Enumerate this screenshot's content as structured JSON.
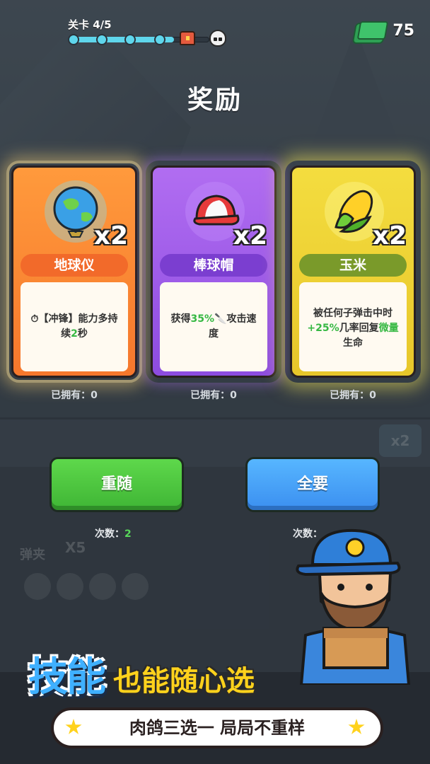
{
  "hud": {
    "level_label": "关卡 4/5",
    "progress": 0.75,
    "cash": "75"
  },
  "title": "奖励",
  "cards": [
    {
      "name": "地球仪",
      "count": "x2",
      "desc_prefix": "⏱【冲锋】能力多持续",
      "desc_highlight": "2",
      "desc_suffix": "秒",
      "owned": "已拥有：0",
      "icon": "globe-icon",
      "color": "#f6772c"
    },
    {
      "name": "棒球帽",
      "count": "x2",
      "desc_prefix": "获得",
      "desc_highlight": "35%",
      "desc_suffix": "🔪攻击速度",
      "owned": "已拥有：0",
      "icon": "baseball-cap-icon",
      "color": "#8d4ce0"
    },
    {
      "name": "玉米",
      "count": "x2",
      "desc_prefix": "被任何子弹击中时",
      "desc_highlight": "+25%",
      "desc_middle": "几率回复",
      "desc_highlight2": "微量",
      "desc_suffix": "生命",
      "owned": "已拥有：0",
      "icon": "corn-icon",
      "color": "#e7c62a"
    }
  ],
  "buttons": {
    "reroll_label": "重随",
    "reroll_times_label": "次数：",
    "reroll_times_value": "2",
    "take_all_label": "全要",
    "take_all_times_label": "次数："
  },
  "inventory": {
    "x2_badge": "x2",
    "slingshot_label": "弹夹",
    "slingshot_count": "X5"
  },
  "promo": {
    "headline_part1": "技能",
    "headline_part2": "也能随心选",
    "subline": "肉鸽三选一 局局不重样"
  }
}
